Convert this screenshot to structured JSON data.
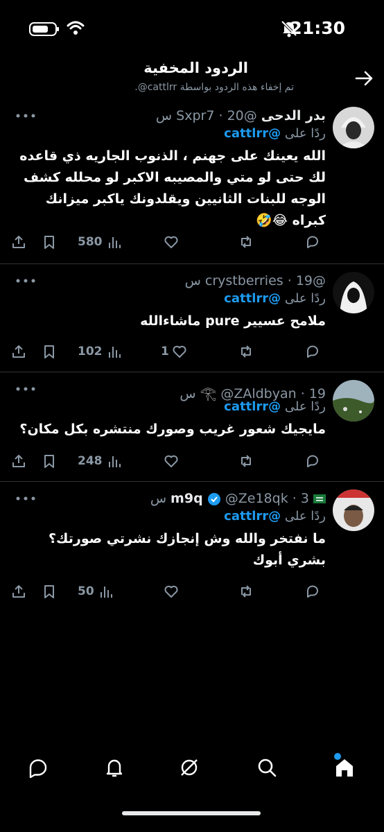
{
  "status_bar": {
    "time": "21:30"
  },
  "header": {
    "title": "الردود المخفية",
    "subtitle": "تم إخفاء هذه الردود بواسطة cattlrr@."
  },
  "replies": [
    {
      "name": "بدر الدحى",
      "handle": "@Sxpr7",
      "time": "20 س",
      "reply_label": "ردًا على",
      "mention": "@cattlrr",
      "text": "الله يعينك على جهنم ، الذنوب الجاريه ذي قاعده لك حتى لو متي والمصيبه الاكبر لو محلله كشف الوجه للبنات الثانيين ويقلدونك ياكبر ميزانك كبراه 😂🤣",
      "views": "580",
      "likes": ""
    },
    {
      "name": "",
      "handle": "@crystberries",
      "time": "19 س",
      "reply_label": "ردًا على",
      "mention": "@cattlrr",
      "text": "ملامح عسيير pure ماشاءالله",
      "views": "102",
      "likes": "1"
    },
    {
      "name": "𓂀",
      "handle": "@ZAldbyan",
      "time": "19 س",
      "reply_label": "ردًا على",
      "mention": "@cattlrr",
      "text": "مايجيك شعور غريب وصورك منتشره بكل مكان؟",
      "views": "248",
      "likes": ""
    },
    {
      "name": "m9q",
      "handle": "@Ze18qk",
      "time": "3 س",
      "reply_label": "ردًا على",
      "mention": "@cattlrr",
      "text": "ما نفتخر والله وش إنجازك نشرتي صورتك؟ بشري أبوك",
      "views": "50",
      "likes": ""
    }
  ],
  "colors": {
    "accent": "#1d9bf0",
    "muted": "#8b98a5",
    "divider": "#2f3336"
  }
}
